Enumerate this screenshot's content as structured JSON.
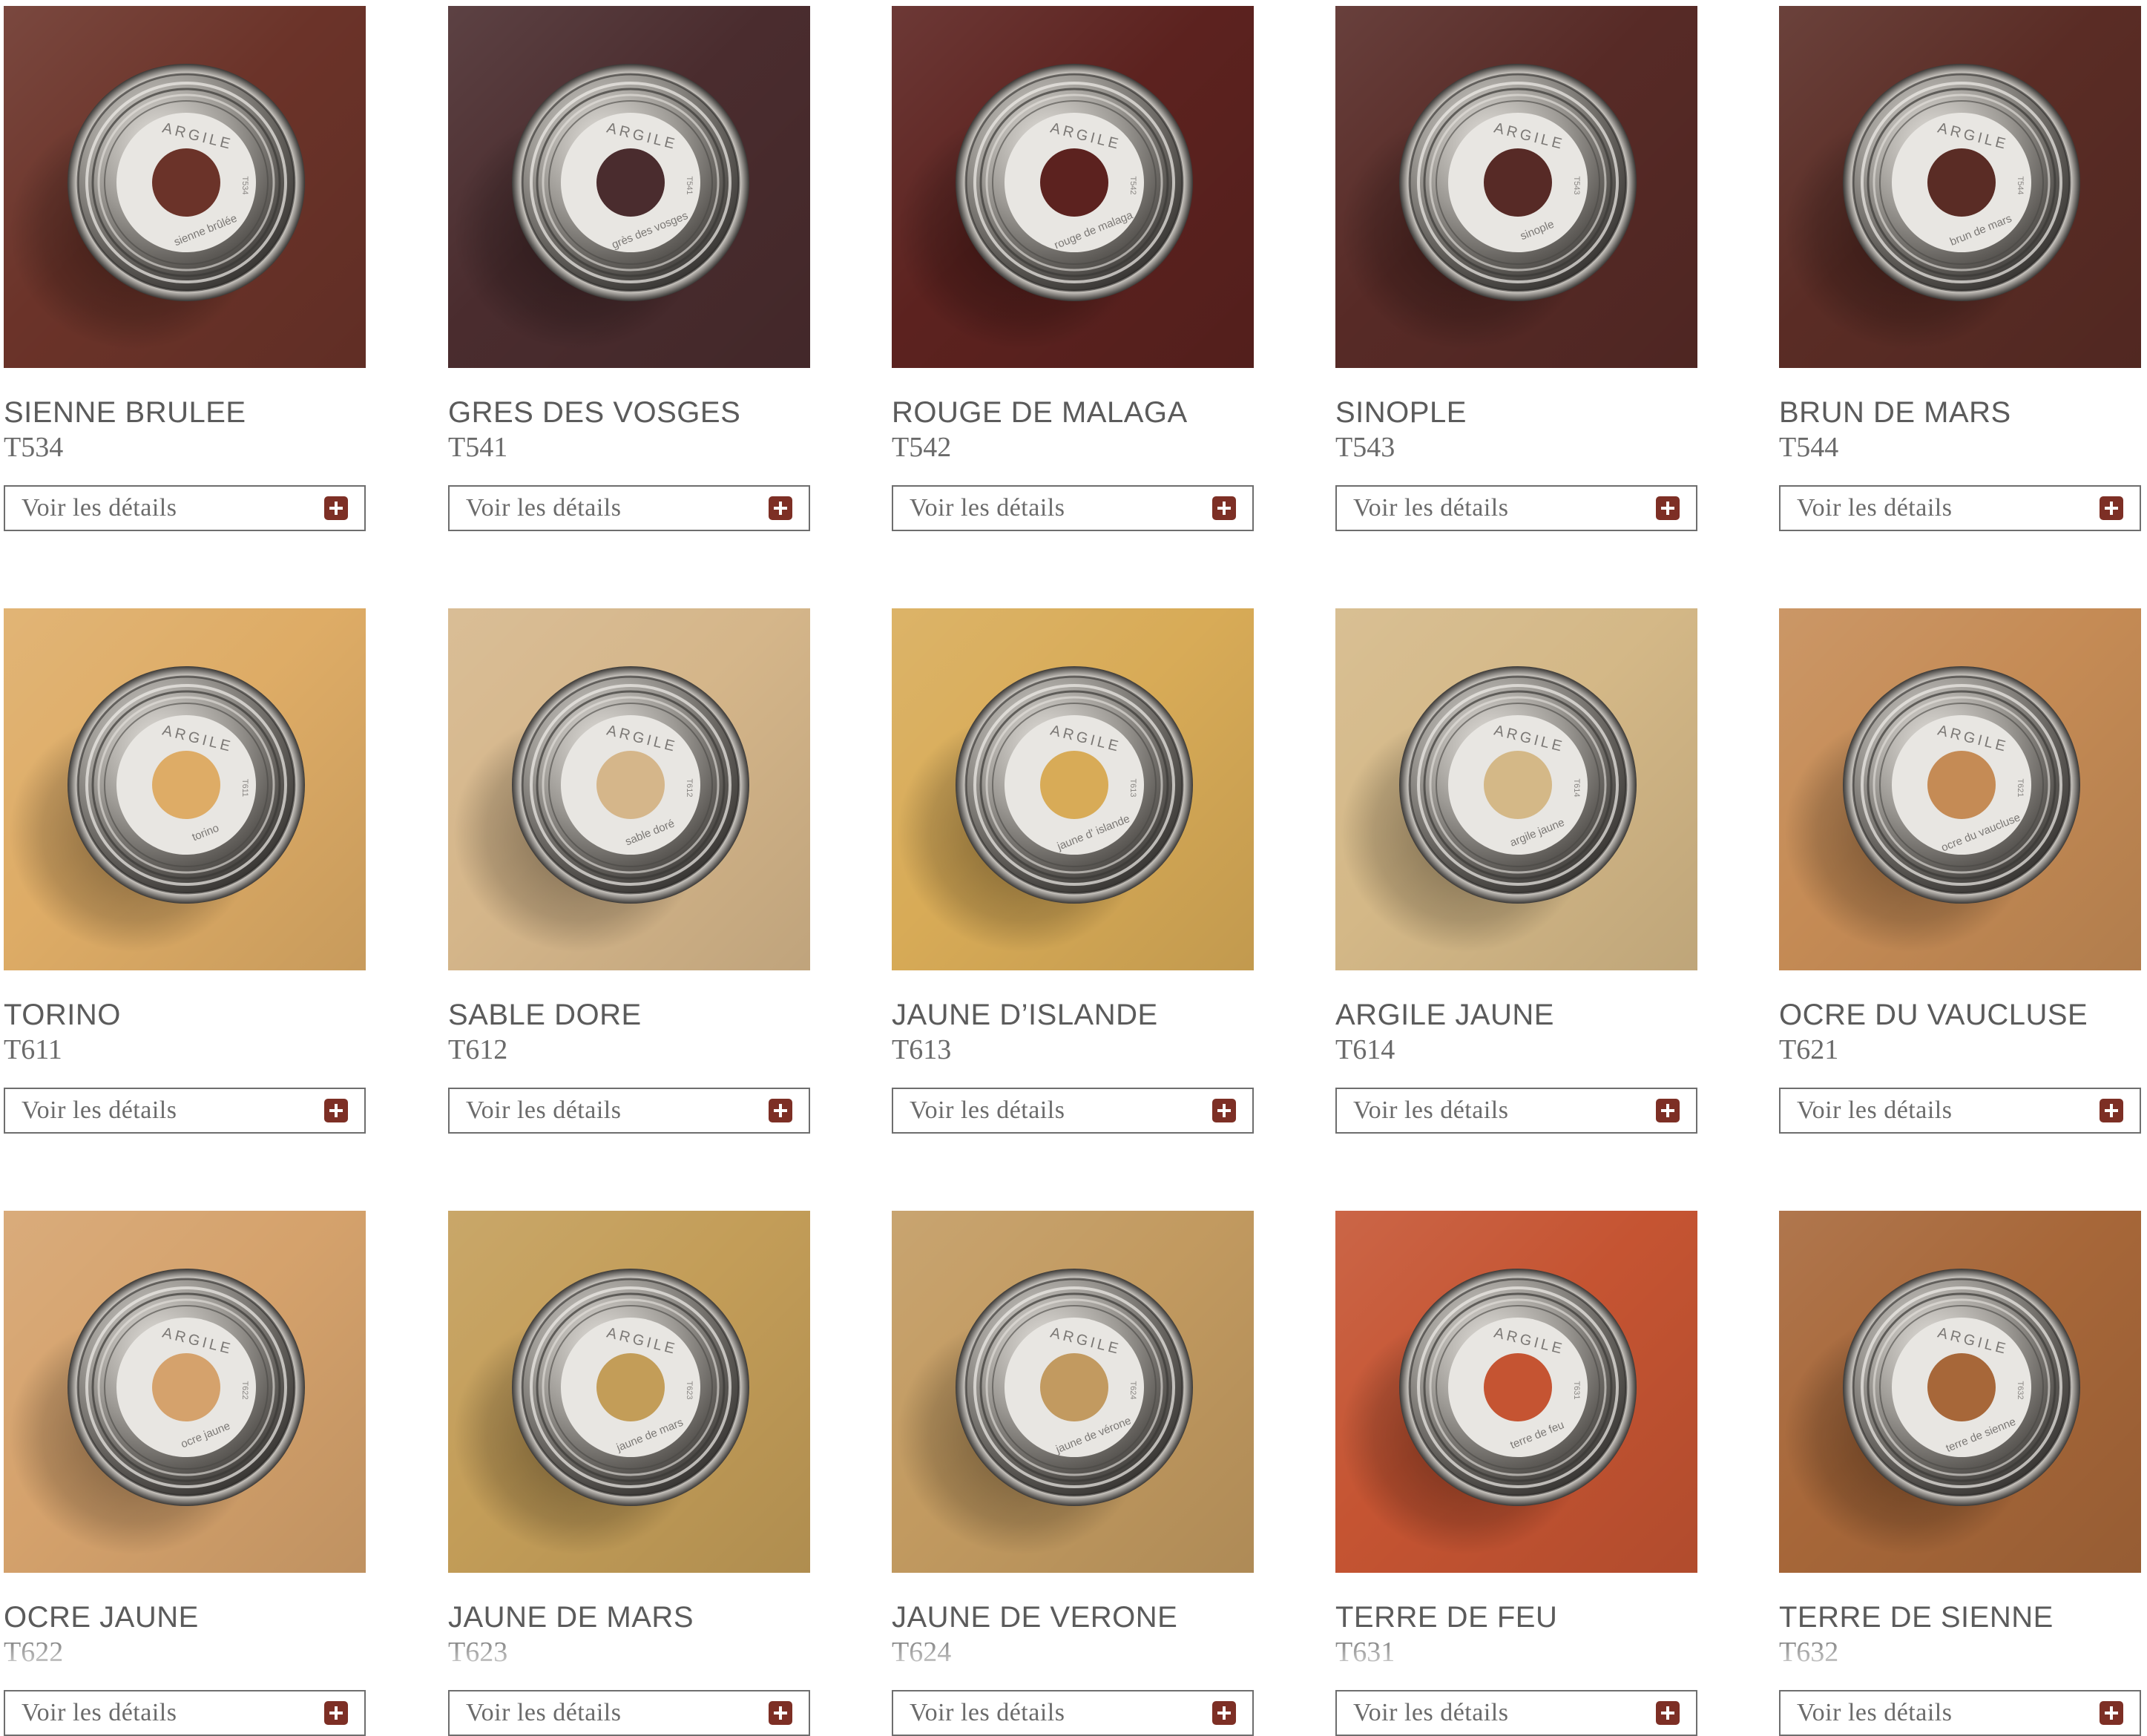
{
  "button_label": "Voir les détails",
  "can_brand": "ARGILE",
  "products": [
    {
      "name": "SIENNE BRULEE",
      "code": "T534",
      "can_label": "sienne brûlée",
      "color": "#6b3329"
    },
    {
      "name": "GRES DES VOSGES",
      "code": "T541",
      "can_label": "grès des vosges",
      "color": "#4a2c2e"
    },
    {
      "name": "ROUGE DE MALAGA",
      "code": "T542",
      "can_label": "rouge de malaga",
      "color": "#5c221f"
    },
    {
      "name": "SINOPLE",
      "code": "T543",
      "can_label": "sinople",
      "color": "#572a26"
    },
    {
      "name": "BRUN DE MARS",
      "code": "T544",
      "can_label": "brun de mars",
      "color": "#5a2c25"
    },
    {
      "name": "TORINO",
      "code": "T611",
      "can_label": "torino",
      "color": "#deac66"
    },
    {
      "name": "SABLE DORE",
      "code": "T612",
      "can_label": "sable doré",
      "color": "#d5b68a"
    },
    {
      "name": "JAUNE D’ISLANDE",
      "code": "T613",
      "can_label": "jaune d' islande",
      "color": "#d8ab57"
    },
    {
      "name": "ARGILE JAUNE",
      "code": "T614",
      "can_label": "argile jaune",
      "color": "#d4b887"
    },
    {
      "name": "OCRE DU VAUCLUSE",
      "code": "T621",
      "can_label": "ocre du vaucluse",
      "color": "#c58b55"
    },
    {
      "name": "OCRE JAUNE",
      "code": "T622",
      "can_label": "ocre jaune",
      "color": "#d5a26c"
    },
    {
      "name": "JAUNE DE MARS",
      "code": "T623",
      "can_label": "jaune de mars",
      "color": "#c39d58"
    },
    {
      "name": "JAUNE DE VERONE",
      "code": "T624",
      "can_label": "jaune de vérone",
      "color": "#c29a60"
    },
    {
      "name": "TERRE DE FEU",
      "code": "T631",
      "can_label": "terre de feu",
      "color": "#c55432"
    },
    {
      "name": "TERRE DE SIENNE",
      "code": "T632",
      "can_label": "terre de sienne",
      "color": "#a76739"
    }
  ]
}
